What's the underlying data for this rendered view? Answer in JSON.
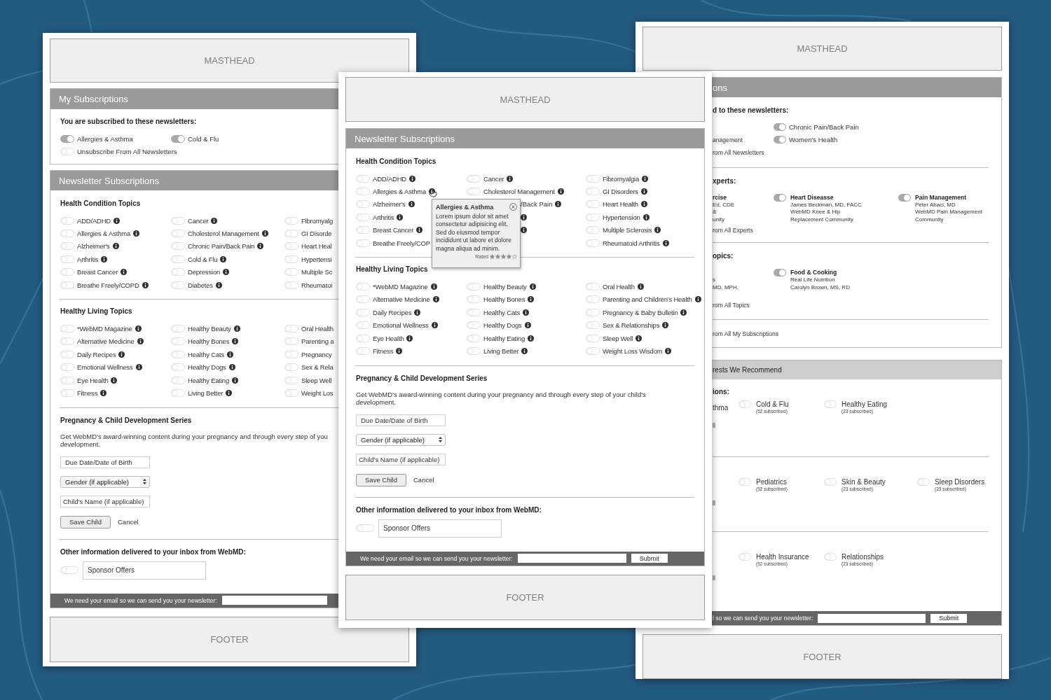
{
  "pages": [
    {
      "kind": "left",
      "masthead": "MASTHEAD",
      "my_subscriptions": {
        "title": "My Subscriptions",
        "intro": "You are subscribed to these newsletters:",
        "items": [
          {
            "label": "Allergies & Asthma",
            "on": true
          },
          {
            "label": "Cold & Flu",
            "on": true
          },
          {
            "label": "Unsubscribe From All Newsletters",
            "on": false
          }
        ]
      },
      "newsletters": {
        "title": "Newsletter Subscriptions",
        "sections": [
          {
            "heading": "Health Condition Topics",
            "columns": [
              [
                {
                  "kind": "toggle",
                  "label": "ADD/ADHD",
                  "on": false,
                  "info": true
                },
                {
                  "kind": "toggle",
                  "label": "Allergies & Asthma",
                  "on": false,
                  "info": true
                },
                {
                  "kind": "toggle",
                  "label": "Alzheimer's",
                  "on": false,
                  "info": true
                },
                {
                  "kind": "toggle",
                  "label": "Arthritis",
                  "on": false,
                  "info": true
                },
                {
                  "kind": "toggle",
                  "label": "Breast Cancer",
                  "on": false,
                  "info": true
                },
                {
                  "kind": "toggle",
                  "label": "Breathe Freely/COPD",
                  "on": false,
                  "info": true
                }
              ],
              [
                {
                  "kind": "toggle",
                  "label": "Cancer",
                  "on": false,
                  "info": true
                },
                {
                  "kind": "toggle",
                  "label": "Cholesterol Management",
                  "on": false,
                  "info": true
                },
                {
                  "kind": "toggle",
                  "label": "Chronic Pain/Back Pain",
                  "on": false,
                  "info": true
                },
                {
                  "kind": "toggle",
                  "label": "Cold & Flu",
                  "on": false,
                  "info": true
                },
                {
                  "kind": "toggle",
                  "label": "Depression",
                  "on": false,
                  "info": true
                },
                {
                  "kind": "toggle",
                  "label": "Diabetes",
                  "on": false,
                  "info": true
                }
              ],
              [
                {
                  "kind": "toggle",
                  "label": "Fibromyalg",
                  "on": false,
                  "info": false
                },
                {
                  "kind": "toggle",
                  "label": "GI Disorde",
                  "on": false,
                  "info": false
                },
                {
                  "kind": "toggle",
                  "label": "Heart Heal",
                  "on": false,
                  "info": false
                },
                {
                  "kind": "toggle",
                  "label": "Hypertensi",
                  "on": false,
                  "info": false
                },
                {
                  "kind": "toggle",
                  "label": "Multiple Sc",
                  "on": false,
                  "info": false
                },
                {
                  "kind": "toggle",
                  "label": "Rheumatoi",
                  "on": false,
                  "info": false
                }
              ]
            ]
          },
          {
            "heading": "Healthy Living Topics",
            "columns": [
              [
                {
                  "kind": "toggle",
                  "label": "*WebMD Magazine",
                  "on": false,
                  "info": true
                },
                {
                  "kind": "toggle",
                  "label": "Alternative Medicine",
                  "on": false,
                  "info": true
                },
                {
                  "kind": "toggle",
                  "label": "Daily Recipes",
                  "on": false,
                  "info": true
                },
                {
                  "kind": "toggle",
                  "label": "Emotional Wellness",
                  "on": false,
                  "info": true
                },
                {
                  "kind": "toggle",
                  "label": "Eye Health",
                  "on": false,
                  "info": true
                },
                {
                  "kind": "toggle",
                  "label": "Fitness",
                  "on": false,
                  "info": true
                }
              ],
              [
                {
                  "kind": "toggle",
                  "label": "Healthy Beauty",
                  "on": false,
                  "info": true
                },
                {
                  "kind": "toggle",
                  "label": "Healthy Bones",
                  "on": false,
                  "info": true
                },
                {
                  "kind": "toggle",
                  "label": "Healthy Cats",
                  "on": false,
                  "info": true
                },
                {
                  "kind": "toggle",
                  "label": "Healthy Dogs",
                  "on": false,
                  "info": true
                },
                {
                  "kind": "toggle",
                  "label": "Healthy Eating",
                  "on": false,
                  "info": true
                },
                {
                  "kind": "toggle",
                  "label": "Living Better",
                  "on": false,
                  "info": true
                }
              ],
              [
                {
                  "kind": "toggle",
                  "label": "Oral Health",
                  "on": false,
                  "info": false
                },
                {
                  "kind": "toggle",
                  "label": "Parenting a",
                  "on": false,
                  "info": false
                },
                {
                  "kind": "toggle",
                  "label": "Pregnancy",
                  "on": false,
                  "info": false
                },
                {
                  "kind": "toggle",
                  "label": "Sex & Rela",
                  "on": false,
                  "info": false
                },
                {
                  "kind": "toggle",
                  "label": "Sleep Well",
                  "on": false,
                  "info": false
                },
                {
                  "kind": "toggle",
                  "label": "Weight Los",
                  "on": false,
                  "info": false
                }
              ]
            ]
          }
        ]
      },
      "pregnancy": {
        "heading": "Pregnancy & Child Development Series",
        "lines": [
          "Get WebMD's award-winning content during your pregnancy and through every step of you",
          "development."
        ],
        "date_placeholder": "Due Date/Date of Birth",
        "gender": "Gender (if applicable)",
        "name_placeholder": "Child's Name (if applicable)",
        "save": "Save Child",
        "cancel": "Cancel"
      },
      "other": {
        "heading": "Other information delivered to your inbox from WebMD:",
        "option": {
          "label": "Sponsor Offers",
          "on": false
        }
      },
      "email_bar": {
        "text": "We need your email so we can send you your newsletter:"
      },
      "footer": "FOOTER"
    },
    {
      "kind": "center",
      "masthead": "MASTHEAD",
      "newsletters": {
        "title": "Newsletter Subscriptions",
        "sections": [
          {
            "heading": "Health Condition Topics",
            "columns": [
              [
                {
                  "kind": "toggle",
                  "label": "ADD/ADHD",
                  "on": false,
                  "info": true
                },
                {
                  "kind": "toggle",
                  "label": "Allergies & Asthma",
                  "on": false,
                  "info": true
                },
                {
                  "kind": "toggle",
                  "label": "Alzheimer's",
                  "on": false,
                  "info": true
                },
                {
                  "kind": "toggle",
                  "label": "Arthritis",
                  "on": false,
                  "info": true
                },
                {
                  "kind": "toggle",
                  "label": "Breast Cancer",
                  "on": false,
                  "info": true
                },
                {
                  "kind": "toggle",
                  "label": "Breathe Freely/COP",
                  "on": false,
                  "info": false
                }
              ],
              [
                {
                  "kind": "toggle",
                  "label": "Cancer",
                  "on": false,
                  "info": true
                },
                {
                  "kind": "toggle",
                  "label": "Cholesterol Management",
                  "on": false,
                  "info": true
                },
                {
                  "kind": "covered",
                  "label": "/Back Pain",
                  "info": true
                },
                {
                  "kind": "covered",
                  "info": true
                },
                {
                  "kind": "covered",
                  "info": true
                }
              ],
              [
                {
                  "kind": "toggle",
                  "label": "Fibromyalgia",
                  "on": false,
                  "info": true
                },
                {
                  "kind": "toggle",
                  "label": "GI Disorders",
                  "on": false,
                  "info": true
                },
                {
                  "kind": "toggle",
                  "label": "Heart Health",
                  "on": false,
                  "info": true
                },
                {
                  "kind": "toggle",
                  "label": "Hypertension",
                  "on": false,
                  "info": true
                },
                {
                  "kind": "toggle",
                  "label": "Multiple Sclerosis",
                  "on": false,
                  "info": true
                },
                {
                  "kind": "toggle",
                  "label": "Rheumatoid Arthritis",
                  "on": false,
                  "info": true
                }
              ]
            ]
          },
          {
            "heading": "Healthy Living Topics",
            "columns": [
              [
                {
                  "kind": "toggle",
                  "label": "*WebMD Magazine",
                  "on": false,
                  "info": true
                },
                {
                  "kind": "toggle",
                  "label": "Alternative Medicine",
                  "on": false,
                  "info": true
                },
                {
                  "kind": "toggle",
                  "label": "Daily Recipes",
                  "on": false,
                  "info": true
                },
                {
                  "kind": "toggle",
                  "label": "Emotional Wellness",
                  "on": false,
                  "info": true
                },
                {
                  "kind": "toggle",
                  "label": "Eye Health",
                  "on": false,
                  "info": true
                },
                {
                  "kind": "toggle",
                  "label": "Fitness",
                  "on": false,
                  "info": true
                }
              ],
              [
                {
                  "kind": "toggle",
                  "label": "Healthy Beauty",
                  "on": false,
                  "info": true
                },
                {
                  "kind": "toggle",
                  "label": "Healthy Bones",
                  "on": false,
                  "info": true
                },
                {
                  "kind": "toggle",
                  "label": "Healthy Cats",
                  "on": false,
                  "info": true
                },
                {
                  "kind": "toggle",
                  "label": "Healthy Dogs",
                  "on": false,
                  "info": true
                },
                {
                  "kind": "toggle",
                  "label": "Healthy Eating",
                  "on": false,
                  "info": true
                },
                {
                  "kind": "toggle",
                  "label": "Living Better",
                  "on": false,
                  "info": true
                }
              ],
              [
                {
                  "kind": "toggle",
                  "label": "Oral Health",
                  "on": false,
                  "info": true
                },
                {
                  "kind": "toggle",
                  "label": "Parenting and Children's Health",
                  "on": false,
                  "info": true
                },
                {
                  "kind": "toggle",
                  "label": "Pregnancy & Baby Bulletin",
                  "on": false,
                  "info": true
                },
                {
                  "kind": "toggle",
                  "label": "Sex & Relationships",
                  "on": false,
                  "info": true
                },
                {
                  "kind": "toggle",
                  "label": "Sleep Well",
                  "on": false,
                  "info": true
                },
                {
                  "kind": "toggle",
                  "label": "Weight Loss Wisdom",
                  "on": false,
                  "info": true
                }
              ]
            ]
          }
        ]
      },
      "tooltip": {
        "title": "Allergies & Asthma",
        "text": "Lorem ipsum dolor sit amet consectetur adipisicing elit. Sed do eiusmod tempor incididunt ut labore et dolore magna aliqua ad minim.",
        "rating_label": "Rated",
        "stars": 4
      },
      "pregnancy": {
        "heading": "Pregnancy & Child Development Series",
        "lines": [
          "Get WebMD's award-winning content during your pregnancy and through every step of your child's",
          "development."
        ],
        "date_placeholder": "Due Date/Date of Birth",
        "gender": "Gender (if applicable)",
        "name_placeholder": "Child's Name (if applicable)",
        "save": "Save Child",
        "cancel": "Cancel"
      },
      "other": {
        "heading": "Other information delivered to your inbox from WebMD:",
        "option": {
          "label": "Sponsor Offers",
          "on": false
        }
      },
      "email_bar": {
        "text": "We need your email so we can send you your newsletter:",
        "submit": "Submit"
      },
      "footer": "FOOTER"
    },
    {
      "kind": "right",
      "masthead": "MASTHEAD",
      "my_subscriptions": {
        "title": "ons",
        "intro": "d to these newsletters:",
        "column_1": [
          "anagement",
          "rom All Newsletters"
        ],
        "column_2": [
          {
            "label": "Chronic Pain/Back Pain",
            "on": true
          },
          {
            "label": "Women's Health",
            "on": true
          }
        ],
        "experts": {
          "heading": "xperts:",
          "entries": [
            {
              "kind": "fragment",
              "title": "rcise",
              "lines": [
                "Ed, CDE",
                "&",
                "unity"
              ]
            },
            {
              "kind": "toggle",
              "title": "Heart Diseasse",
              "on": true,
              "lines": [
                "James Beckman, MD, FACC",
                "WebMD Knee & Hip",
                "Replacement Community"
              ]
            },
            {
              "kind": "toggle",
              "title": "Pain Management",
              "on": true,
              "lines": [
                "Peter Abaci, MD",
                "WebMD Pain Management",
                "Community"
              ]
            }
          ],
          "footer": "rom All Experts"
        },
        "topics": {
          "heading": "opics:",
          "entries": [
            {
              "kind": "fragment",
              "lines": [
                "s",
                "MD, MPH,"
              ]
            },
            {
              "kind": "toggle",
              "title": "Food & Cooking",
              "on": true,
              "lines": [
                "Real Life Nutrition",
                "Carolyn Brown, MS, RD"
              ]
            }
          ],
          "footer": "rom All Topics"
        },
        "unsubscribe_all": "rom All My Subscriptions"
      },
      "recommend": {
        "title": "rests We Recommend",
        "groups": [
          {
            "heading": "ions:",
            "fragment": "thma",
            "items": [
              {
                "label": "Cold & Flu",
                "count": "(52 subscribed)",
                "on": false
              },
              {
                "label": "Healthy Eating",
                "count": "(23 subscribed)",
                "on": false
              }
            ],
            "footer": "ll"
          },
          {
            "items": [
              {
                "label": "Pediatrics",
                "count": "(52 subscribed)",
                "on": false
              },
              {
                "label": "Skin & Beauty",
                "count": "(23 subscribed)",
                "on": false
              },
              {
                "label": "Sleep Disorders",
                "count": "(23 subscribed)",
                "on": false
              }
            ],
            "footer": "ll"
          },
          {
            "items": [
              {
                "label": "Health Insurance",
                "count": "(52 subscribed)",
                "on": false
              },
              {
                "label": "Relationships",
                "count": "(23 subscribed)",
                "on": false
              }
            ],
            "footer": "ll"
          }
        ]
      },
      "email_bar": {
        "text": "l so we can send you your newsletter:",
        "submit": "Submit"
      },
      "footer": "FOOTER"
    }
  ]
}
